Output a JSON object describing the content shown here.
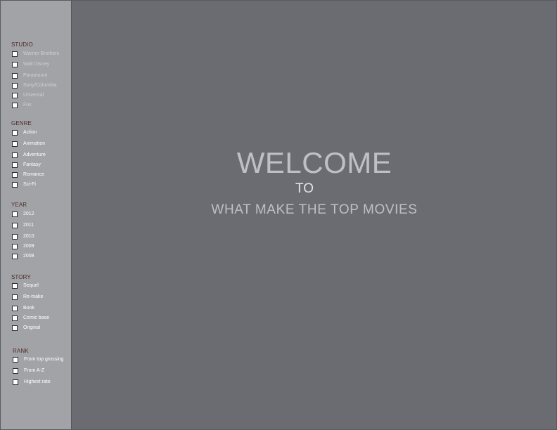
{
  "sidebar": {
    "studio": {
      "title": "STUDIO",
      "items": [
        "Warner Brothers",
        "Walt Disney",
        "Paramount",
        "Sony/Columbia",
        "Universal",
        "Fox"
      ]
    },
    "genre": {
      "title": "GENRE",
      "items": [
        "Action",
        "Animation",
        "Adventure",
        "Fantasy",
        "Romance",
        "Sci-Fi"
      ]
    },
    "year": {
      "title": "YEAR",
      "items": [
        "2012",
        "2011",
        "2010",
        "2009",
        "2008"
      ]
    },
    "story": {
      "title": "STORY",
      "items": [
        "Sequel",
        "Re-make",
        "Book",
        "Comic base",
        "Original"
      ]
    },
    "rank": {
      "title": "RANK",
      "items": [
        "From top grossing",
        "From A-Z",
        "Highest rate"
      ]
    }
  },
  "main": {
    "welcome": "WELCOME",
    "to": "TO",
    "subtitle": "WHAT MAKE THE TOP MOVIES"
  },
  "colors": {
    "sidebar_bg": "#a2a3a7",
    "main_bg": "#6b6c71",
    "section_title": "#4b2b25"
  }
}
